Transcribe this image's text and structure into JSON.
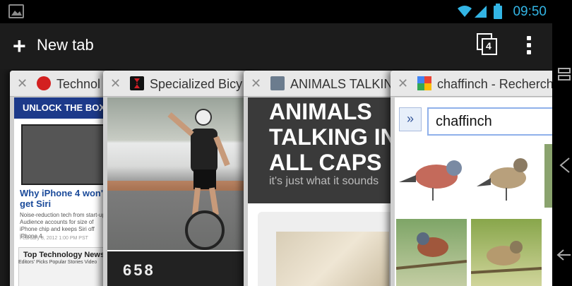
{
  "status_bar": {
    "time": "09:50",
    "gallery_icon": "gallery-icon",
    "wifi_icon": "wifi-icon",
    "signal_icon": "signal-icon",
    "battery_icon": "battery-icon",
    "accent": "#33b5e5"
  },
  "action_bar": {
    "new_tab_label": "New tab",
    "tab_count": "4"
  },
  "tabs": [
    {
      "title": "Technol",
      "favicon": "tech-site-icon"
    },
    {
      "title": "Specialized Bicy",
      "favicon": "bicycle-brand-icon"
    },
    {
      "title": "ANIMALS TALKING",
      "favicon": "profile-thumbnail-icon"
    },
    {
      "title": "chaffinch - Recherch",
      "favicon": "google-icon"
    }
  ],
  "card1": {
    "banner": "UNLOCK THE BOX",
    "headline": "Why iPhone 4 won't get Siri",
    "snippet": "Noise-reduction tech from start-up Audience accounts for size of iPhone chip and keeps Siri off iPhone 4.",
    "date": "February 8, 2012 1:00 PM PST",
    "box_title": "Top Technology News",
    "box_tabs": "Editors' Picks   Popular   Stories   Video"
  },
  "card2": {
    "counter": "658"
  },
  "card3": {
    "heading": "ANIMALS TALKING IN ALL CAPS",
    "subheading": "it's just what it sounds"
  },
  "card4": {
    "search_value": "chaffinch",
    "arrow": "»"
  }
}
